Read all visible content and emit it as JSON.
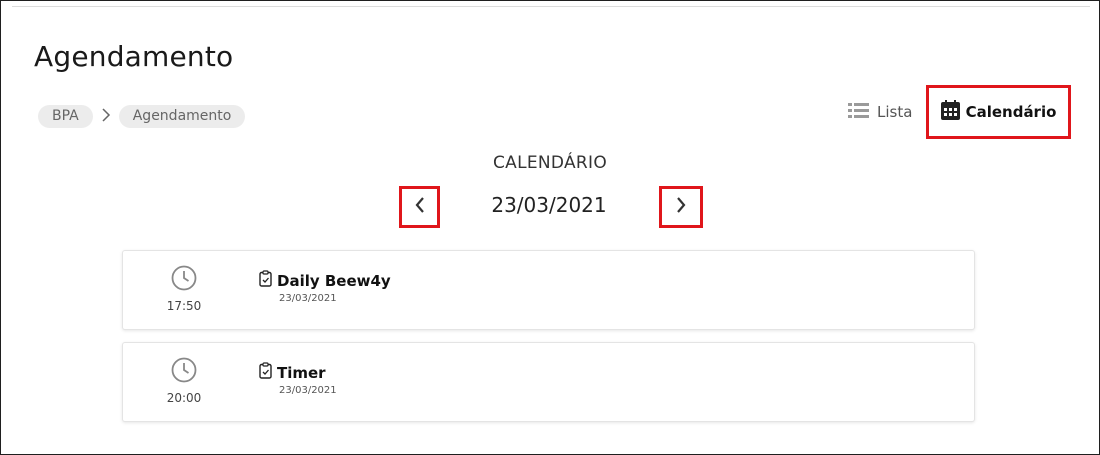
{
  "page": {
    "title": "Agendamento"
  },
  "breadcrumb": {
    "items": [
      "BPA",
      "Agendamento"
    ]
  },
  "view_toggle": {
    "list_label": "Lista",
    "calendar_label": "Calendário",
    "active": "calendar"
  },
  "calendar": {
    "heading": "CALENDÁRIO",
    "current_date": "23/03/2021"
  },
  "events": [
    {
      "time": "17:50",
      "title": "Daily Beew4y",
      "date": "23/03/2021"
    },
    {
      "time": "20:00",
      "title": "Timer",
      "date": "23/03/2021"
    }
  ],
  "colors": {
    "highlight_border": "#e0161b",
    "chip_bg": "#ececec",
    "icon_gray": "#8a8a8a"
  }
}
